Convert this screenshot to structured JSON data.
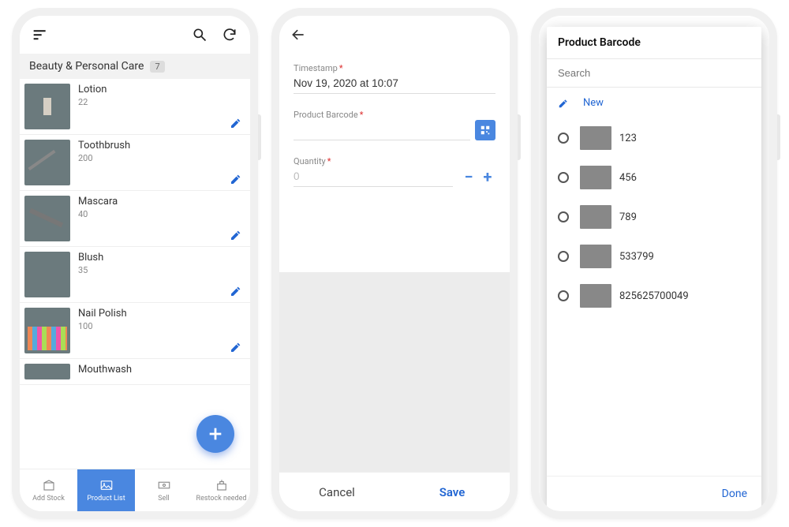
{
  "phone1": {
    "category": "Beauty & Personal Care",
    "count": "7",
    "items": [
      {
        "name": "Lotion",
        "qty": "22"
      },
      {
        "name": "Toothbrush",
        "qty": "200"
      },
      {
        "name": "Mascara",
        "qty": "40"
      },
      {
        "name": "Blush",
        "qty": "35"
      },
      {
        "name": "Nail Polish",
        "qty": "100"
      },
      {
        "name": "Mouthwash",
        "qty": ""
      }
    ],
    "tabs": [
      {
        "label": "Add Stock"
      },
      {
        "label": "Product List"
      },
      {
        "label": "Sell"
      },
      {
        "label": "Restock needed"
      }
    ]
  },
  "phone2": {
    "fields": {
      "timestamp_label": "Timestamp",
      "timestamp_value": "Nov 19, 2020 at 10:07",
      "barcode_label": "Product Barcode",
      "qty_label": "Quantity",
      "qty_placeholder": "0"
    },
    "actions": {
      "cancel": "Cancel",
      "save": "Save"
    }
  },
  "phone3": {
    "title": "Product Barcode",
    "search_placeholder": "Search",
    "new_label": "New",
    "options": [
      {
        "code": "123"
      },
      {
        "code": "456"
      },
      {
        "code": "789"
      },
      {
        "code": "533799"
      },
      {
        "code": "825625700049"
      }
    ],
    "done": "Done"
  }
}
